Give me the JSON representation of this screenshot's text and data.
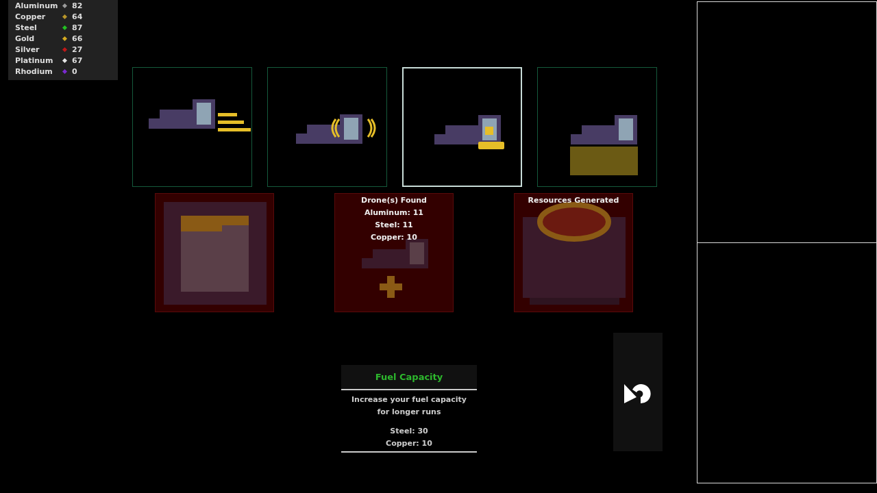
{
  "resources": [
    {
      "name": "Aluminum",
      "value": "82",
      "color": "#9a9a9a"
    },
    {
      "name": "Copper",
      "value": "64",
      "color": "#b8962a"
    },
    {
      "name": "Steel",
      "value": "87",
      "color": "#22c022"
    },
    {
      "name": "Gold",
      "value": "66",
      "color": "#d4aa20"
    },
    {
      "name": "Silver",
      "value": "27",
      "color": "#c01818"
    },
    {
      "name": "Platinum",
      "value": "67",
      "color": "#e6e6e6"
    },
    {
      "name": "Rhodium",
      "value": "0",
      "color": "#7a2ad0"
    }
  ],
  "upgrades": [
    {
      "kind": "speed",
      "selected": false
    },
    {
      "kind": "shield",
      "selected": false
    },
    {
      "kind": "fuel",
      "selected": true
    },
    {
      "kind": "cargo",
      "selected": false
    }
  ],
  "results": [
    {
      "kind": "crate"
    },
    {
      "kind": "drone",
      "title": "Drone(s) Found",
      "lines": [
        "Aluminum: 11",
        "Steel: 11",
        "Copper: 10"
      ]
    },
    {
      "kind": "furnace",
      "title": "Resources Generated"
    }
  ],
  "tooltip": {
    "title": "Fuel Capacity",
    "description": "Increase your fuel capacity for longer runs",
    "costs": [
      "Steel: 30",
      "Copper: 10"
    ]
  }
}
